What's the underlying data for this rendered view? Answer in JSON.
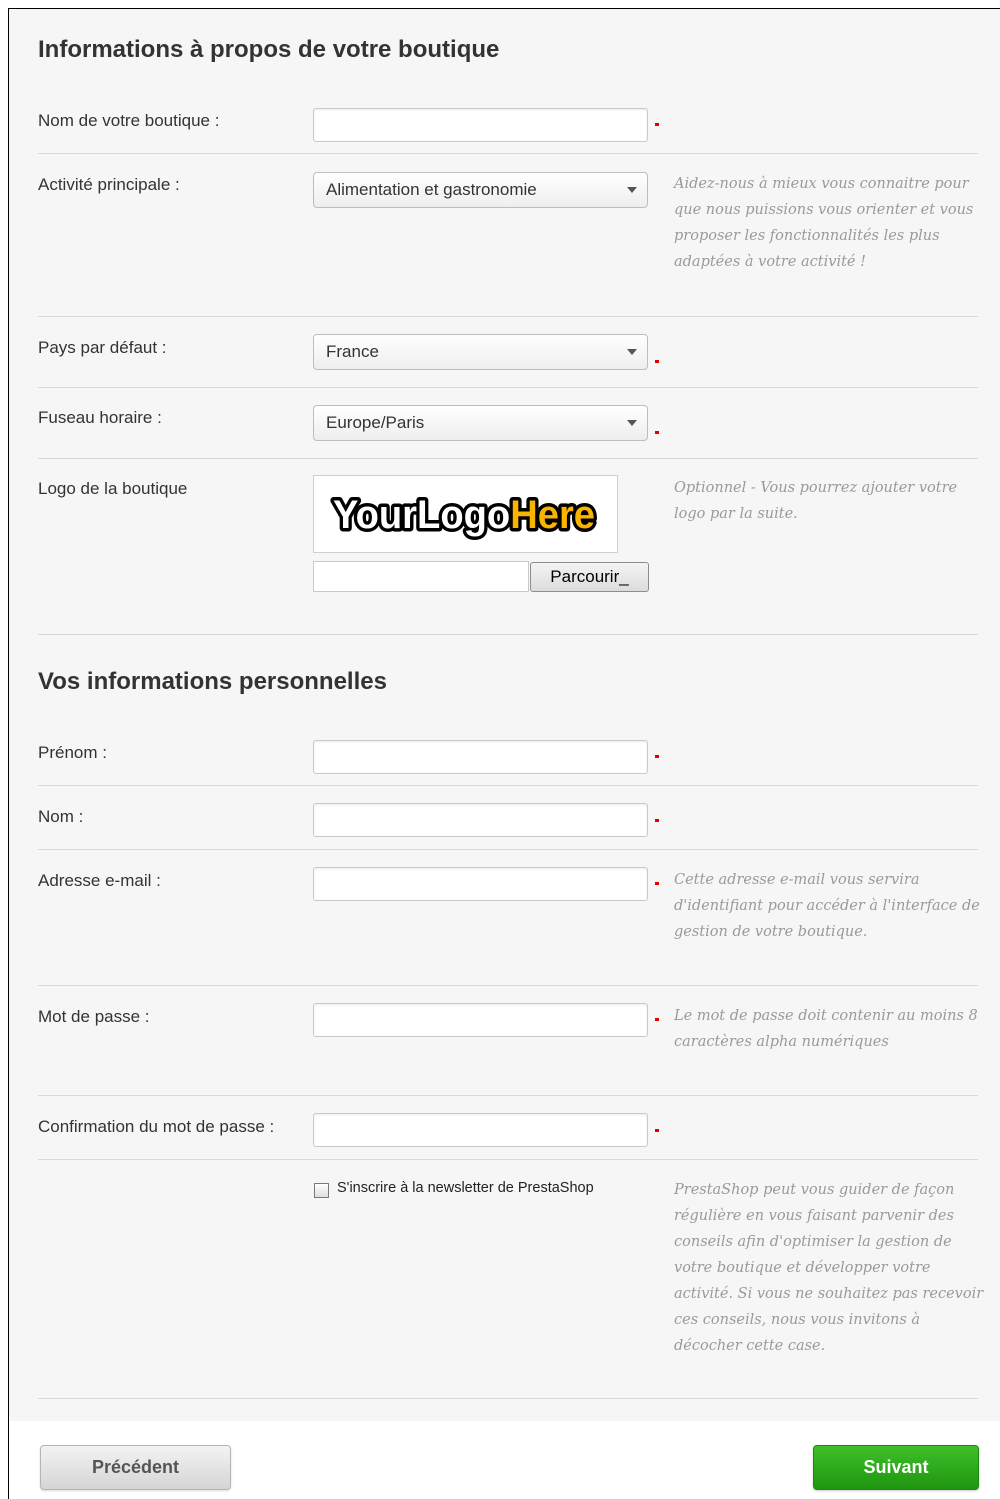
{
  "colors": {
    "panel_bg": "#f6f6f6",
    "required_marker": "#e00000",
    "next_button": "#2aa81a",
    "hint_text": "#9a9a9a",
    "logo_yellow": "#f7b500"
  },
  "shop_section": {
    "title": "Informations à propos de votre boutique",
    "shop_name_label": "Nom de votre boutique :",
    "shop_name_value": "",
    "activity_label": "Activité principale :",
    "activity_value": "Alimentation et gastronomie",
    "activity_hint": "Aidez-nous à mieux vous connaitre pour que nous puissions vous orienter et vous proposer les fonctionnalités les plus adaptées à votre activité !",
    "country_label": "Pays par défaut :",
    "country_value": "France",
    "timezone_label": "Fuseau horaire :",
    "timezone_value": "Europe/Paris",
    "logo_label": "Logo de la boutique",
    "logo_text_part1": "YourLogo",
    "logo_text_part2": "Here",
    "logo_hint": "Optionnel - Vous pourrez ajouter votre logo par la suite.",
    "browse_label": "Parcourir_"
  },
  "personal_section": {
    "title": "Vos informations personnelles",
    "firstname_label": "Prénom :",
    "firstname_value": "",
    "lastname_label": "Nom :",
    "lastname_value": "",
    "email_label": "Adresse e-mail :",
    "email_value": "",
    "email_hint": "Cette adresse e-mail vous servira d'identifiant pour accéder à l'interface de gestion de votre boutique.",
    "password_label": "Mot de passe :",
    "password_value": "",
    "password_hint": "Le mot de passe doit contenir au moins 8 caractères alpha numériques",
    "confirm_label": "Confirmation du mot de passe :",
    "confirm_value": "",
    "newsletter_label": "S'inscrire à la newsletter de PrestaShop",
    "newsletter_checked": false,
    "newsletter_hint": "PrestaShop peut vous guider de façon régulière en vous faisant parvenir des conseils afin d'optimiser la gestion de votre boutique et développer votre activité. Si vous ne souhaitez pas recevoir ces conseils, nous vous invitons à décocher cette case."
  },
  "navigation": {
    "previous_label": "Précédent",
    "next_label": "Suivant"
  }
}
